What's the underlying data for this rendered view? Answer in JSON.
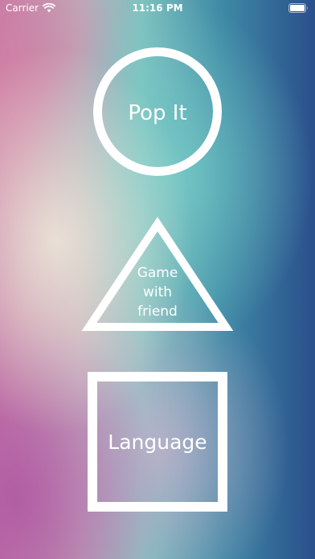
{
  "status_bar": {
    "carrier": "Carrier",
    "time": "11:16 PM",
    "wifi_icon": "wifi-icon",
    "battery_icon": "battery-icon"
  },
  "menu": {
    "pop_it": {
      "label": "Pop It",
      "shape": "circle"
    },
    "game_with_friend": {
      "label_lines": [
        "Game",
        "with",
        "friend"
      ],
      "shape": "triangle"
    },
    "language": {
      "label": "Language",
      "shape": "square"
    }
  },
  "colors": {
    "foreground": "#ffffff",
    "gradient_left": "#c77aa5",
    "gradient_center": "#7fc2c0",
    "gradient_right": "#2a4f8c"
  }
}
